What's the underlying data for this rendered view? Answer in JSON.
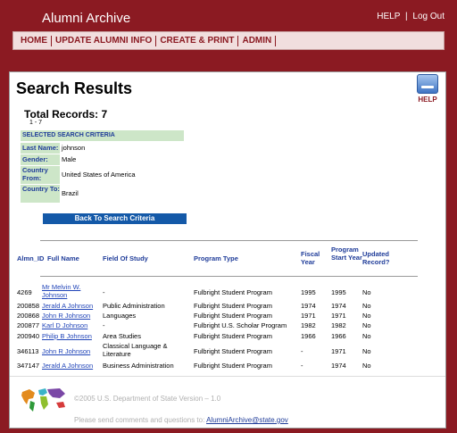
{
  "header": {
    "title": "Alumni Archive",
    "help_link": "HELP",
    "separator": "|",
    "logout_link": "Log Out"
  },
  "nav": {
    "items": [
      "HOME",
      "UPDATE ALUMNI INFO",
      "CREATE & PRINT",
      "ADMIN"
    ]
  },
  "page": {
    "title": "Search Results",
    "help_label": "HELP",
    "total_records": "Total Records: 7",
    "range": "1 - 7",
    "criteria_header": "SELECTED SEARCH CRITERIA",
    "criteria": [
      {
        "label": "Last Name:",
        "value": "johnson"
      },
      {
        "label": "Gender:",
        "value": "Male"
      },
      {
        "label": "Country From:",
        "value": "United States of America"
      },
      {
        "label": "Country To:",
        "value": "Brazil"
      }
    ],
    "back_button": "Back To Search Criteria"
  },
  "table": {
    "headers": {
      "id": "Almn_ID",
      "name": "Full Name",
      "field": "Field Of Study",
      "program_type": "Program Type",
      "fiscal_year": "Fiscal Year",
      "start_year": "Program Start Year",
      "updated": "Updated Record?"
    },
    "rows": [
      {
        "id": "4269",
        "name": "Mr Melvin W. Johnson",
        "field": "-",
        "program_type": "Fulbright Student Program",
        "fiscal_year": "1995",
        "start_year": "1995",
        "updated": "No"
      },
      {
        "id": "200858",
        "name": "Jerald A Johnson",
        "field": "Public Administration",
        "program_type": "Fulbright Student Program",
        "fiscal_year": "1974",
        "start_year": "1974",
        "updated": "No"
      },
      {
        "id": "200868",
        "name": "John R Johnson",
        "field": "Languages",
        "program_type": "Fulbright Student Program",
        "fiscal_year": "1971",
        "start_year": "1971",
        "updated": "No"
      },
      {
        "id": "200877",
        "name": "Karl D Johnson",
        "field": "-",
        "program_type": "Fulbright U.S. Scholar Program",
        "fiscal_year": "1982",
        "start_year": "1982",
        "updated": "No"
      },
      {
        "id": "200940",
        "name": "Philip B Johnson",
        "field": "Area Studies",
        "program_type": "Fulbright Student Program",
        "fiscal_year": "1966",
        "start_year": "1966",
        "updated": "No"
      },
      {
        "id": "346113",
        "name": "John R Johnson",
        "field": "Classical Language & Literature",
        "program_type": "Fulbright Student Program",
        "fiscal_year": "-",
        "start_year": "1971",
        "updated": "No"
      },
      {
        "id": "347147",
        "name": "Jerald A Johnson",
        "field": "Business Administration",
        "program_type": "Fulbright Student Program",
        "fiscal_year": "-",
        "start_year": "1974",
        "updated": "No"
      }
    ]
  },
  "footer": {
    "copyright": "©2005 U.S. Department of State  Version – 1.0",
    "feedback_text": "Please send comments and questions to:",
    "email": "AlumniArchive@state.gov",
    "map_icon": "world-map-icon"
  },
  "colors": {
    "brand": "#8b1a22",
    "link": "#2044b8",
    "label_bg": "#cde6c8",
    "button": "#1459a8"
  }
}
